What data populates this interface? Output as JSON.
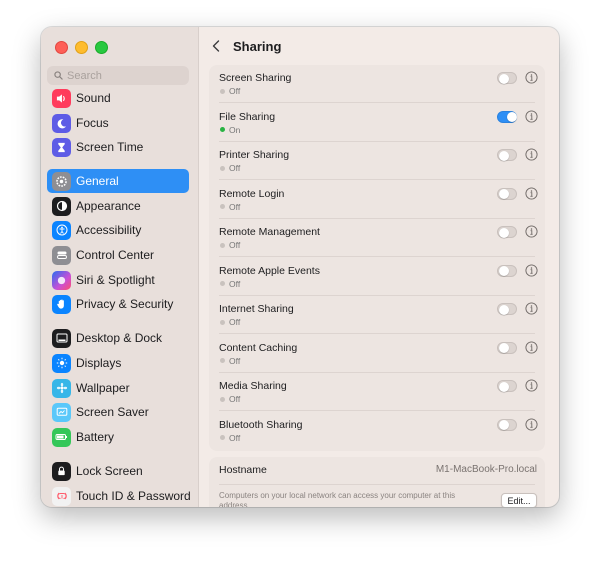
{
  "search": {
    "placeholder": "Search"
  },
  "sidebar": {
    "items": [
      {
        "label": "Sound",
        "icon": "speaker-icon",
        "color": "#ff3b5c"
      },
      {
        "label": "Focus",
        "icon": "moon-icon",
        "color": "#5e5ce6"
      },
      {
        "label": "Screen Time",
        "icon": "hourglass-icon",
        "color": "#5e5ce6"
      },
      {
        "label": "General",
        "icon": "gear-icon",
        "color": "#8e8e93",
        "active": true
      },
      {
        "label": "Appearance",
        "icon": "appearance-icon",
        "color": "#1d1d1f"
      },
      {
        "label": "Accessibility",
        "icon": "accessibility-icon",
        "color": "#0a84ff"
      },
      {
        "label": "Control Center",
        "icon": "control-center-icon",
        "color": "#8e8e93"
      },
      {
        "label": "Siri & Spotlight",
        "icon": "siri-icon",
        "color": "#c94fd6"
      },
      {
        "label": "Privacy & Security",
        "icon": "hand-icon",
        "color": "#0a84ff"
      },
      {
        "label": "Desktop & Dock",
        "icon": "dock-icon",
        "color": "#1d1d1f"
      },
      {
        "label": "Displays",
        "icon": "sun-icon",
        "color": "#0a84ff"
      },
      {
        "label": "Wallpaper",
        "icon": "wallpaper-icon",
        "color": "#36b6e8"
      },
      {
        "label": "Screen Saver",
        "icon": "screen-saver-icon",
        "color": "#5ac8fa"
      },
      {
        "label": "Battery",
        "icon": "battery-icon",
        "color": "#34c759"
      },
      {
        "label": "Lock Screen",
        "icon": "lock-icon",
        "color": "#1d1d1f"
      },
      {
        "label": "Touch ID & Password",
        "icon": "fingerprint-icon",
        "color": "#ff6a6a"
      }
    ]
  },
  "header": {
    "title": "Sharing"
  },
  "sharing": {
    "services": [
      {
        "name": "Screen Sharing",
        "status": "Off",
        "enabled": false
      },
      {
        "name": "File Sharing",
        "status": "On",
        "enabled": true
      },
      {
        "name": "Printer Sharing",
        "status": "Off",
        "enabled": false
      },
      {
        "name": "Remote Login",
        "status": "Off",
        "enabled": false
      },
      {
        "name": "Remote Management",
        "status": "Off",
        "enabled": false
      },
      {
        "name": "Remote Apple Events",
        "status": "Off",
        "enabled": false
      },
      {
        "name": "Internet Sharing",
        "status": "Off",
        "enabled": false
      },
      {
        "name": "Content Caching",
        "status": "Off",
        "enabled": false
      },
      {
        "name": "Media Sharing",
        "status": "Off",
        "enabled": false
      },
      {
        "name": "Bluetooth Sharing",
        "status": "Off",
        "enabled": false
      }
    ]
  },
  "hostname": {
    "label": "Hostname",
    "value": "M1-MacBook-Pro.local",
    "description": "Computers on your local network can access your computer at this address.",
    "edit_label": "Edit..."
  }
}
